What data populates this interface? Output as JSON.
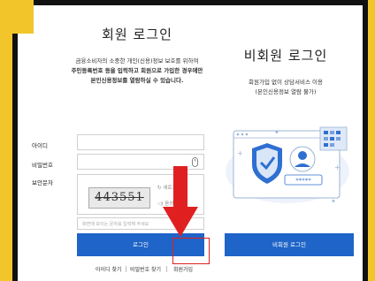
{
  "member": {
    "title": "회원 로그인",
    "desc": [
      "금융소비자의 소중한 개인(신용)정보 보호를 위하여",
      "주민등록번호 등을 입력하고 회원으로 가입한 경우에만",
      "본인신용정보를 열람하실 수 있습니다."
    ],
    "id_label": "아이디",
    "pw_label": "비밀번호",
    "captcha_label": "보안문자",
    "captcha_text": "443551",
    "refresh_label": "새로고침",
    "audio_label": "음성듣기",
    "captcha_placeholder": "화면에 보이는 문자를 입력해 주세요",
    "login_button": "로그인",
    "links": [
      "아이디 찾기",
      "비밀번호 찾기",
      "회원가입"
    ]
  },
  "guest": {
    "title": "비회원 로그인",
    "desc": [
      "회원가입 없이 상담서비스 이용",
      "(본인신용정보 열람 불가)"
    ],
    "password_mask": "*****",
    "login_button": "비회원 로그인"
  },
  "colors": {
    "accent": "#1f64c8",
    "highlight": "#e02020",
    "background": "#f2c62b"
  }
}
